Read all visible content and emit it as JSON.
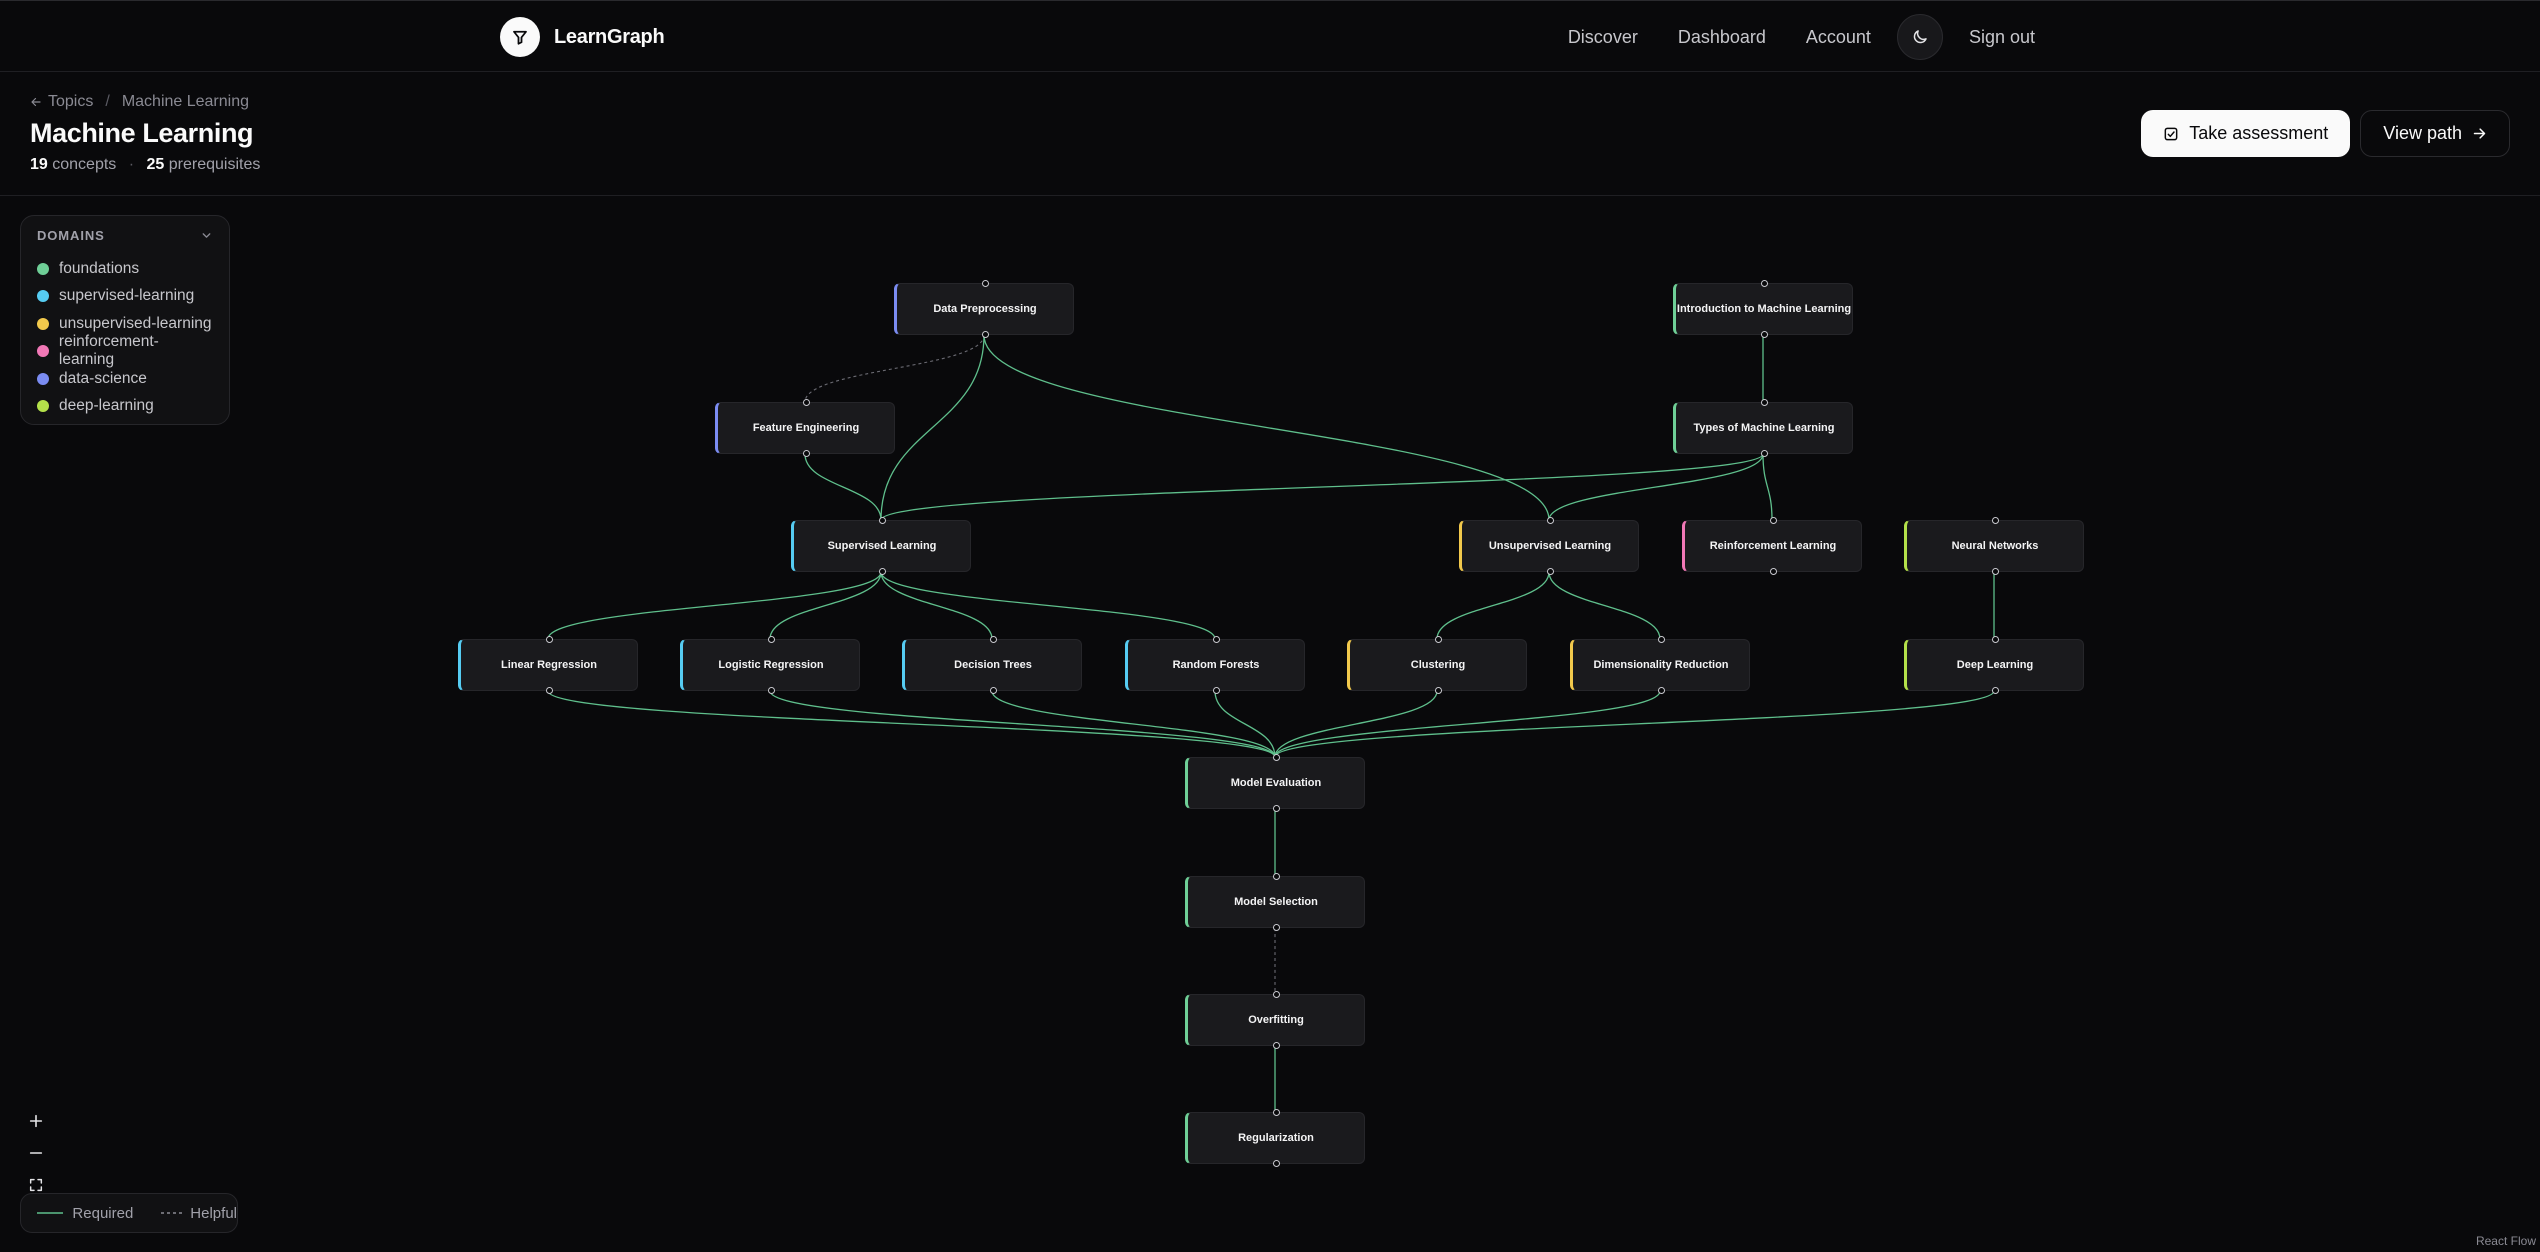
{
  "header": {
    "brand": "LearnGraph",
    "nav": [
      "Discover",
      "Dashboard",
      "Account"
    ],
    "sign_out": "Sign out",
    "icons": {
      "logo": "filter-icon",
      "theme": "moon-icon"
    }
  },
  "page": {
    "breadcrumb": {
      "back": "Topics",
      "current": "Machine Learning"
    },
    "title": "Machine Learning",
    "stats": {
      "concepts_count": "19",
      "concepts_label": "concepts",
      "prereq_count": "25",
      "prereq_label": "prerequisites"
    },
    "actions": {
      "assessment": "Take assessment",
      "view_path": "View path"
    }
  },
  "domains": {
    "title": "DOMAINS",
    "items": [
      {
        "label": "foundations",
        "color": "#6fcf97"
      },
      {
        "label": "supervised-learning",
        "color": "#56ccf2"
      },
      {
        "label": "unsupervised-learning",
        "color": "#f2c94c"
      },
      {
        "label": "reinforcement-learning",
        "color": "#f178b6"
      },
      {
        "label": "data-science",
        "color": "#7b8cf2"
      },
      {
        "label": "deep-learning",
        "color": "#b4e14a"
      }
    ]
  },
  "graph": {
    "nodes": [
      {
        "id": "dp",
        "label": "Data Preprocessing",
        "domain": "data-science"
      },
      {
        "id": "iml",
        "label": "Introduction to Machine Learning",
        "domain": "foundations"
      },
      {
        "id": "fe",
        "label": "Feature Engineering",
        "domain": "data-science"
      },
      {
        "id": "tml",
        "label": "Types of Machine Learning",
        "domain": "foundations"
      },
      {
        "id": "sl",
        "label": "Supervised Learning",
        "domain": "supervised-learning"
      },
      {
        "id": "ul",
        "label": "Unsupervised Learning",
        "domain": "unsupervised-learning"
      },
      {
        "id": "rl",
        "label": "Reinforcement Learning",
        "domain": "reinforcement-learning"
      },
      {
        "id": "nn",
        "label": "Neural Networks",
        "domain": "deep-learning"
      },
      {
        "id": "lr",
        "label": "Linear Regression",
        "domain": "supervised-learning"
      },
      {
        "id": "lgr",
        "label": "Logistic Regression",
        "domain": "supervised-learning"
      },
      {
        "id": "dt",
        "label": "Decision Trees",
        "domain": "supervised-learning"
      },
      {
        "id": "rf",
        "label": "Random Forests",
        "domain": "supervised-learning"
      },
      {
        "id": "cl",
        "label": "Clustering",
        "domain": "unsupervised-learning"
      },
      {
        "id": "dr",
        "label": "Dimensionality Reduction",
        "domain": "unsupervised-learning"
      },
      {
        "id": "dl",
        "label": "Deep Learning",
        "domain": "deep-learning"
      },
      {
        "id": "me",
        "label": "Model Evaluation",
        "domain": "foundations"
      },
      {
        "id": "ms",
        "label": "Model Selection",
        "domain": "foundations"
      },
      {
        "id": "of",
        "label": "Overfitting",
        "domain": "foundations"
      },
      {
        "id": "rg",
        "label": "Regularization",
        "domain": "foundations"
      }
    ],
    "edges": [
      {
        "from": "dp",
        "to": "fe",
        "kind": "helpful"
      },
      {
        "from": "dp",
        "to": "sl",
        "kind": "required"
      },
      {
        "from": "dp",
        "to": "ul",
        "kind": "required"
      },
      {
        "from": "iml",
        "to": "tml",
        "kind": "required"
      },
      {
        "from": "fe",
        "to": "sl",
        "kind": "required"
      },
      {
        "from": "tml",
        "to": "sl",
        "kind": "required"
      },
      {
        "from": "tml",
        "to": "ul",
        "kind": "required"
      },
      {
        "from": "tml",
        "to": "rl",
        "kind": "required"
      },
      {
        "from": "sl",
        "to": "lr",
        "kind": "required"
      },
      {
        "from": "sl",
        "to": "lgr",
        "kind": "required"
      },
      {
        "from": "sl",
        "to": "dt",
        "kind": "required"
      },
      {
        "from": "sl",
        "to": "rf",
        "kind": "required"
      },
      {
        "from": "ul",
        "to": "cl",
        "kind": "required"
      },
      {
        "from": "ul",
        "to": "dr",
        "kind": "required"
      },
      {
        "from": "nn",
        "to": "dl",
        "kind": "required"
      },
      {
        "from": "lr",
        "to": "me",
        "kind": "required"
      },
      {
        "from": "lgr",
        "to": "me",
        "kind": "required"
      },
      {
        "from": "dt",
        "to": "me",
        "kind": "required"
      },
      {
        "from": "rf",
        "to": "me",
        "kind": "required"
      },
      {
        "from": "cl",
        "to": "me",
        "kind": "required"
      },
      {
        "from": "dr",
        "to": "me",
        "kind": "required"
      },
      {
        "from": "dl",
        "to": "me",
        "kind": "required"
      },
      {
        "from": "me",
        "to": "ms",
        "kind": "required"
      },
      {
        "from": "ms",
        "to": "of",
        "kind": "helpful"
      },
      {
        "from": "of",
        "to": "rg",
        "kind": "required"
      }
    ],
    "edge_colors": {
      "required": "#5fbf8c",
      "helpful": "#6b6b73"
    }
  },
  "legend": {
    "required": "Required",
    "helpful": "Helpful"
  },
  "controls": {
    "icons": [
      "plus-icon",
      "minus-icon",
      "fit-view-icon"
    ]
  },
  "watermark": "React Flow"
}
